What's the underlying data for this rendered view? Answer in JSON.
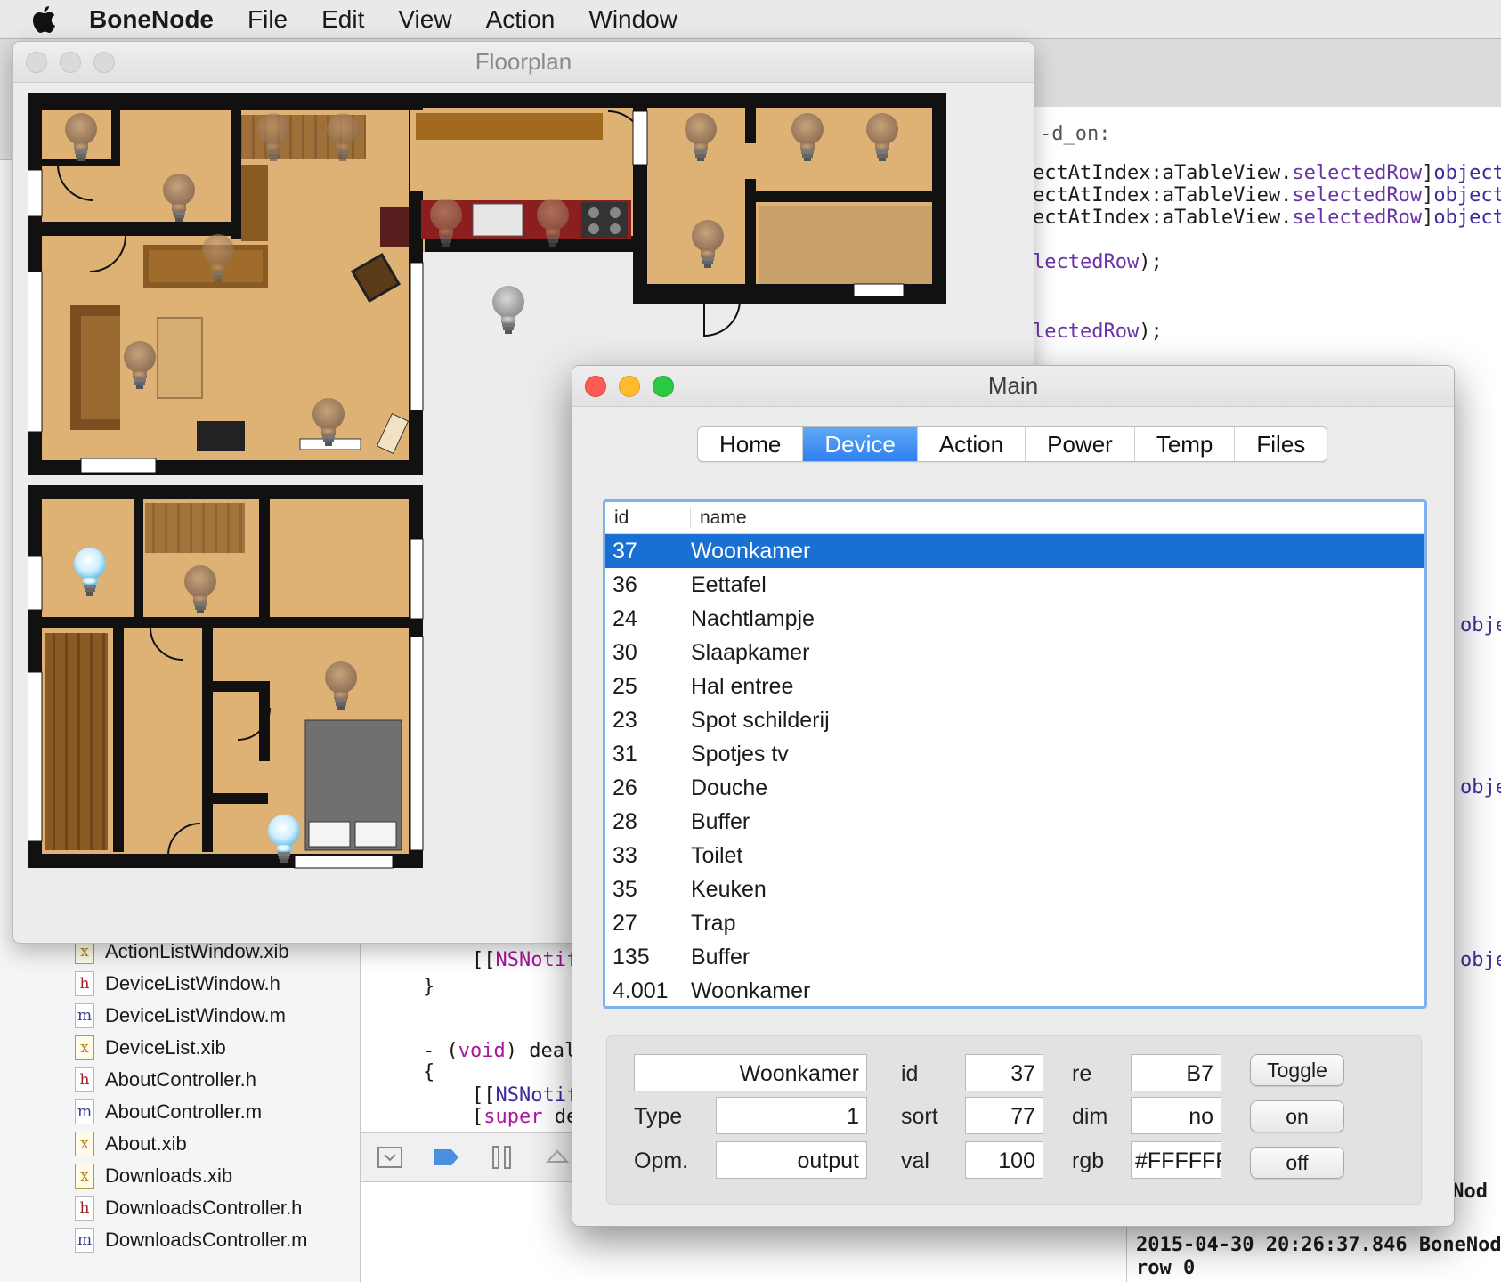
{
  "menubar": {
    "app_name": "BoneNode",
    "menus": [
      "File",
      "Edit",
      "View",
      "Action",
      "Window"
    ]
  },
  "xcode": {
    "right_code": [
      "-d_on:",
      "ectAtIndex:aTableView.selectedRow]object",
      "ectAtIndex:aTableView.selectedRow]object",
      "ectAtIndex:aTableView.selectedRow]object",
      "lectedRow);",
      "lectedRow);",
      "obje",
      "obje",
      "obje"
    ],
    "center_code": [
      "[[NSNotif",
      "}",
      "- (void) deal",
      "{",
      "[[NSNotif",
      "[super de"
    ],
    "files": [
      {
        "type": "xib",
        "glyph": "x",
        "name": "ActionListWindow.xib"
      },
      {
        "type": "h",
        "glyph": "h",
        "name": "DeviceListWindow.h"
      },
      {
        "type": "m",
        "glyph": "m",
        "name": "DeviceListWindow.m"
      },
      {
        "type": "xib",
        "glyph": "x",
        "name": "DeviceList.xib"
      },
      {
        "type": "h",
        "glyph": "h",
        "name": "AboutController.h"
      },
      {
        "type": "m",
        "glyph": "m",
        "name": "AboutController.m"
      },
      {
        "type": "xib",
        "glyph": "x",
        "name": "About.xib"
      },
      {
        "type": "xib",
        "glyph": "x",
        "name": "Downloads.xib"
      },
      {
        "type": "h",
        "glyph": "h",
        "name": "DownloadsController.h"
      },
      {
        "type": "m",
        "glyph": "m",
        "name": "DownloadsController.m"
      }
    ],
    "console_lines": [
      "eNod",
      "2015-04-30 20:26:37.846 BoneNod",
      "row 0"
    ]
  },
  "floorplan": {
    "title": "Floorplan"
  },
  "main": {
    "title": "Main",
    "tabs": [
      {
        "label": "Home",
        "active": false
      },
      {
        "label": "Device",
        "active": true
      },
      {
        "label": "Action",
        "active": false
      },
      {
        "label": "Power",
        "active": false
      },
      {
        "label": "Temp",
        "active": false
      },
      {
        "label": "Files",
        "active": false
      }
    ],
    "table": {
      "col_id": "id",
      "col_name": "name",
      "rows": [
        {
          "id": "37",
          "name": "Woonkamer",
          "selected": true
        },
        {
          "id": "36",
          "name": "Eettafel"
        },
        {
          "id": "24",
          "name": "Nachtlampje"
        },
        {
          "id": "30",
          "name": "Slaapkamer"
        },
        {
          "id": "25",
          "name": "Hal entree"
        },
        {
          "id": "23",
          "name": "Spot schilderij"
        },
        {
          "id": "31",
          "name": "Spotjes tv"
        },
        {
          "id": "26",
          "name": "Douche"
        },
        {
          "id": "28",
          "name": "Buffer"
        },
        {
          "id": "33",
          "name": "Toilet"
        },
        {
          "id": "35",
          "name": "Keuken"
        },
        {
          "id": "27",
          "name": "Trap"
        },
        {
          "id": "135",
          "name": "Buffer"
        },
        {
          "id": "4.001",
          "name": "Woonkamer"
        }
      ]
    },
    "detail": {
      "name_value": "Woonkamer",
      "type_label": "Type",
      "type_value": "1",
      "opm_label": "Opm.",
      "opm_value": "output",
      "id_label": "id",
      "id_value": "37",
      "sort_label": "sort",
      "sort_value": "77",
      "val_label": "val",
      "val_value": "100",
      "re_label": "re",
      "re_value": "B7",
      "dim_label": "dim",
      "dim_value": "no",
      "rgb_label": "rgb",
      "rgb_value": "#FFFFFF",
      "toggle_label": "Toggle",
      "on_label": "on",
      "off_label": "off"
    }
  }
}
